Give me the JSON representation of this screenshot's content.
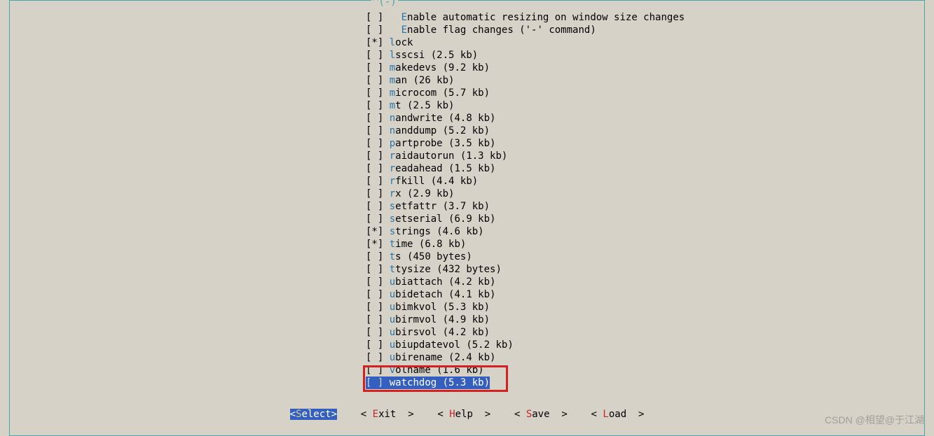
{
  "scroll_indicator": "^(-)",
  "items": [
    {
      "bracket": "[ ]",
      "indent": "   ",
      "hot": "E",
      "rest": "nable automatic resizing on window size changes",
      "selected": false
    },
    {
      "bracket": "[ ]",
      "indent": "   ",
      "hot": "E",
      "rest": "nable flag changes ('-' command)",
      "selected": false
    },
    {
      "bracket": "[*]",
      "indent": " ",
      "hot": "l",
      "rest": "ock",
      "selected": false
    },
    {
      "bracket": "[ ]",
      "indent": " ",
      "hot": "l",
      "rest": "sscsi (2.5 kb)",
      "selected": false
    },
    {
      "bracket": "[ ]",
      "indent": " ",
      "hot": "m",
      "rest": "akedevs (9.2 kb)",
      "selected": false
    },
    {
      "bracket": "[ ]",
      "indent": " ",
      "hot": "m",
      "rest": "an (26 kb)",
      "selected": false
    },
    {
      "bracket": "[ ]",
      "indent": " ",
      "hot": "m",
      "rest": "icrocom (5.7 kb)",
      "selected": false
    },
    {
      "bracket": "[ ]",
      "indent": " ",
      "hot": "m",
      "rest": "t (2.5 kb)",
      "selected": false
    },
    {
      "bracket": "[ ]",
      "indent": " ",
      "hot": "n",
      "rest": "andwrite (4.8 kb)",
      "selected": false
    },
    {
      "bracket": "[ ]",
      "indent": " ",
      "hot": "n",
      "rest": "anddump (5.2 kb)",
      "selected": false
    },
    {
      "bracket": "[ ]",
      "indent": " ",
      "hot": "p",
      "rest": "artprobe (3.5 kb)",
      "selected": false
    },
    {
      "bracket": "[ ]",
      "indent": " ",
      "hot": "r",
      "rest": "aidautorun (1.3 kb)",
      "selected": false
    },
    {
      "bracket": "[ ]",
      "indent": " ",
      "hot": "r",
      "rest": "eadahead (1.5 kb)",
      "selected": false
    },
    {
      "bracket": "[ ]",
      "indent": " ",
      "hot": "r",
      "rest": "fkill (4.4 kb)",
      "selected": false
    },
    {
      "bracket": "[ ]",
      "indent": " ",
      "hot": "r",
      "rest": "x (2.9 kb)",
      "selected": false
    },
    {
      "bracket": "[ ]",
      "indent": " ",
      "hot": "s",
      "rest": "etfattr (3.7 kb)",
      "selected": false
    },
    {
      "bracket": "[ ]",
      "indent": " ",
      "hot": "s",
      "rest": "etserial (6.9 kb)",
      "selected": false
    },
    {
      "bracket": "[*]",
      "indent": " ",
      "hot": "s",
      "rest": "trings (4.6 kb)",
      "selected": false
    },
    {
      "bracket": "[*]",
      "indent": " ",
      "hot": "t",
      "rest": "ime (6.8 kb)",
      "selected": false
    },
    {
      "bracket": "[ ]",
      "indent": " ",
      "hot": "t",
      "rest": "s (450 bytes)",
      "selected": false
    },
    {
      "bracket": "[ ]",
      "indent": " ",
      "hot": "t",
      "rest": "tysize (432 bytes)",
      "selected": false
    },
    {
      "bracket": "[ ]",
      "indent": " ",
      "hot": "u",
      "rest": "biattach (4.2 kb)",
      "selected": false
    },
    {
      "bracket": "[ ]",
      "indent": " ",
      "hot": "u",
      "rest": "bidetach (4.1 kb)",
      "selected": false
    },
    {
      "bracket": "[ ]",
      "indent": " ",
      "hot": "u",
      "rest": "bimkvol (5.3 kb)",
      "selected": false
    },
    {
      "bracket": "[ ]",
      "indent": " ",
      "hot": "u",
      "rest": "birmvol (4.9 kb)",
      "selected": false
    },
    {
      "bracket": "[ ]",
      "indent": " ",
      "hot": "u",
      "rest": "birsvol (4.2 kb)",
      "selected": false
    },
    {
      "bracket": "[ ]",
      "indent": " ",
      "hot": "u",
      "rest": "biupdatevol (5.2 kb)",
      "selected": false
    },
    {
      "bracket": "[ ]",
      "indent": " ",
      "hot": "u",
      "rest": "birename (2.4 kb)",
      "selected": false
    },
    {
      "bracket": "[ ]",
      "indent": " ",
      "hot": "v",
      "rest": "olname (1.6 kb)",
      "selected": false
    },
    {
      "bracket": "[ ]",
      "indent": " ",
      "hot": "w",
      "rest": "atchdog (5.3 kb)",
      "selected": true
    }
  ],
  "buttons": [
    {
      "open": "<",
      "hot": "S",
      "rest": "elect",
      "close": ">",
      "selected": true,
      "name": "select-button"
    },
    {
      "open": "< ",
      "hot": "E",
      "rest": "xit ",
      "close": " >",
      "selected": false,
      "name": "exit-button"
    },
    {
      "open": "< ",
      "hot": "H",
      "rest": "elp ",
      "close": " >",
      "selected": false,
      "name": "help-button"
    },
    {
      "open": "< ",
      "hot": "S",
      "rest": "ave ",
      "close": " >",
      "selected": false,
      "name": "save-button"
    },
    {
      "open": "< ",
      "hot": "L",
      "rest": "oad ",
      "close": " >",
      "selected": false,
      "name": "load-button"
    }
  ],
  "button_gap": "    ",
  "watermark": "CSDN @相望@于江湖"
}
